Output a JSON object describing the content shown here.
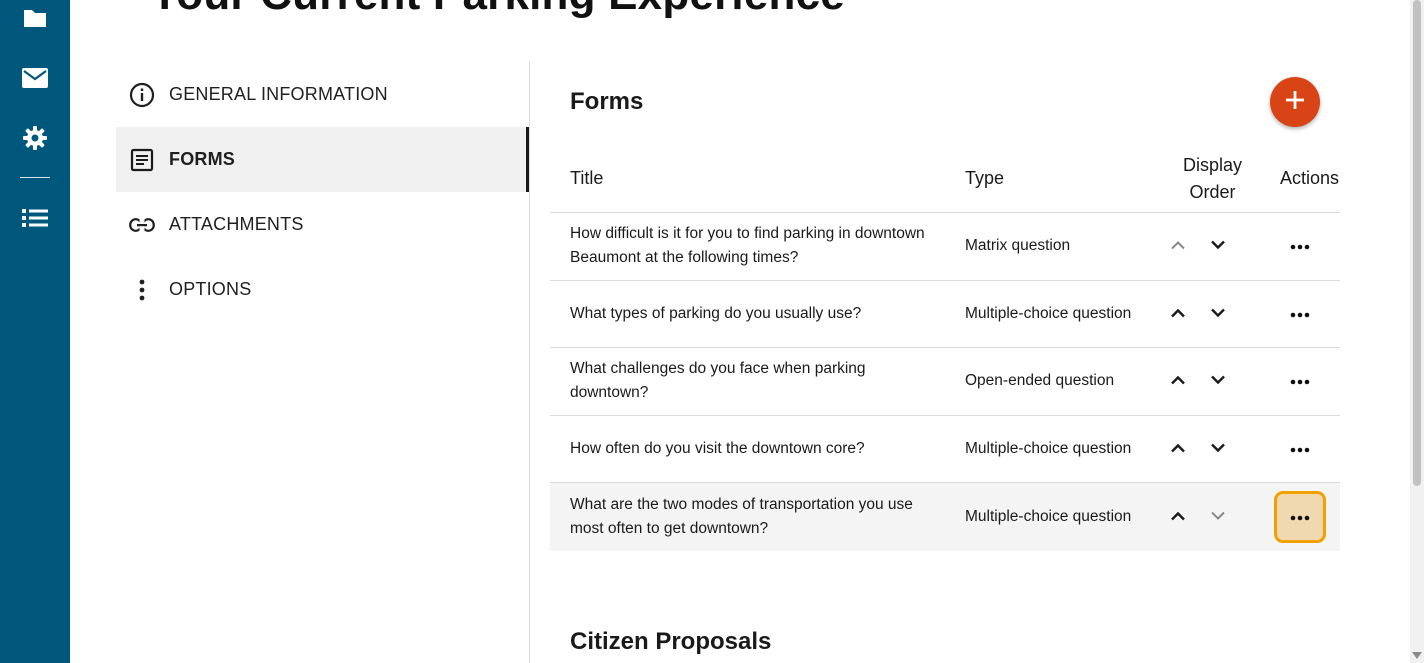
{
  "page": {
    "title": "Your Current Parking Experience"
  },
  "rail": {
    "items": [
      {
        "icon": "folder-icon"
      },
      {
        "icon": "mail-icon"
      },
      {
        "icon": "gear-icon"
      },
      {
        "icon": "list-icon"
      }
    ]
  },
  "section_nav": {
    "items": [
      {
        "label": "GENERAL INFORMATION",
        "icon": "info-icon"
      },
      {
        "label": "FORMS",
        "icon": "document-icon",
        "active": true
      },
      {
        "label": "ATTACHMENTS",
        "icon": "link-icon"
      },
      {
        "label": "OPTIONS",
        "icon": "more-vertical-icon"
      }
    ]
  },
  "forms": {
    "heading": "Forms",
    "add_icon": "plus-icon",
    "columns": {
      "title": "Title",
      "type": "Type",
      "display_order_line1": "Display",
      "display_order_line2": "Order",
      "actions": "Actions"
    },
    "rows": [
      {
        "title": "How difficult is it for you to find parking in downtown Beaumont at the following times?",
        "type": "Matrix question"
      },
      {
        "title": "What types of parking do you usually use?",
        "type": "Multiple-choice question"
      },
      {
        "title": "What challenges do you face when parking downtown?",
        "type": "Open-ended question"
      },
      {
        "title": "How often do you visit the downtown core?",
        "type": "Multiple-choice question"
      },
      {
        "title": "What are the two modes of transportation you use most often to get downtown?",
        "type": "Multiple-choice question"
      }
    ]
  },
  "proposals": {
    "heading": "Citizen Proposals"
  },
  "colors": {
    "rail": "#00577c",
    "accent": "#d84415",
    "focus": "#f0a000"
  }
}
